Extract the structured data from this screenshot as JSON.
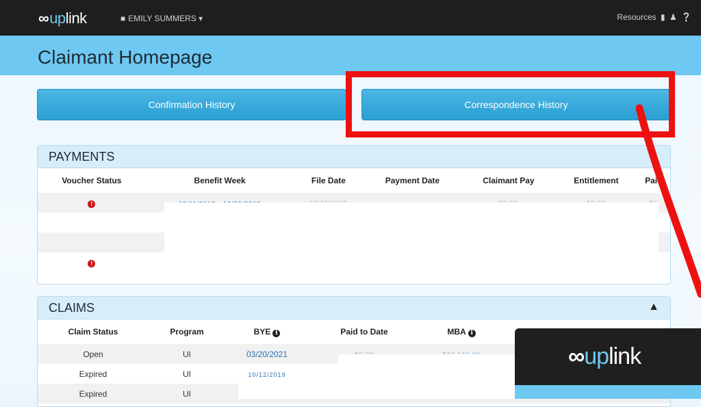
{
  "app": {
    "logo_oo": "∞",
    "logo_up": "up",
    "logo_link": "link",
    "user_name": "EMILY SUMMERS",
    "resources_label": "Resources"
  },
  "page": {
    "title": "Claimant Homepage"
  },
  "buttons": {
    "confirmation": "Confirmation History",
    "correspondence": "Correspondence History"
  },
  "payments": {
    "title": "PAYMENTS",
    "columns": [
      "Voucher Status",
      "Benefit Week",
      "File Date",
      "Payment Date",
      "Claimant Pay",
      "Entitlement",
      "Paid"
    ],
    "rows": [
      {
        "benefit_week": "12/11/2018 - 12/29/2018",
        "file_date": "12/29/2018",
        "claimant_pay": "$0.00",
        "entitlement": "$0.00",
        "paid": "$0"
      }
    ]
  },
  "claims": {
    "title": "CLAIMS",
    "columns": [
      "Claim Status",
      "Program",
      "BYE",
      "Paid to Date",
      "MBA"
    ],
    "rows": [
      {
        "status": "Open",
        "program": "UI",
        "bye": "03/20/2021",
        "paid_to_date": "$0.00",
        "mba": "$10,140.00"
      },
      {
        "status": "Expired",
        "program": "UI",
        "bye": "10/12/2019"
      },
      {
        "status": "Expired",
        "program": "UI"
      }
    ]
  },
  "colors": {
    "accent": "#6ec8f2",
    "highlight": "#ee1111",
    "button": "#2a9fd3"
  }
}
